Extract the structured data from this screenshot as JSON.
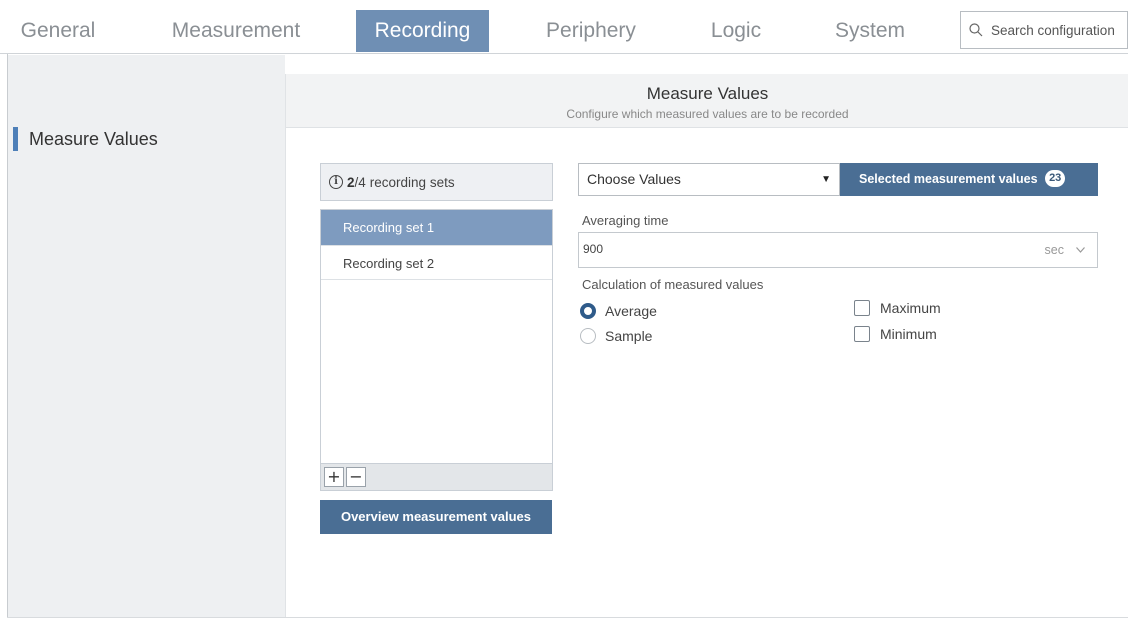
{
  "nav": {
    "tabs": [
      {
        "label": "General"
      },
      {
        "label": "Measurement"
      },
      {
        "label": "Recording"
      },
      {
        "label": "Periphery"
      },
      {
        "label": "Logic"
      },
      {
        "label": "System"
      }
    ],
    "active_tab": "Recording",
    "search_placeholder": "Search configuration"
  },
  "sidebar": {
    "items": [
      {
        "label": "Measure Values"
      }
    ]
  },
  "main": {
    "title": "Measure Values",
    "subtitle": "Configure which measured values are to be recorded",
    "recording_sets": {
      "used": "2",
      "total": "/4",
      "suffix": "recording sets",
      "items": [
        {
          "label": "Recording set 1"
        },
        {
          "label": "Recording set 2"
        }
      ],
      "selected_index": 0,
      "add_label": "+",
      "remove_label": "−"
    },
    "overview_button": "Overview measurement values",
    "choose_values": "Choose Values",
    "selected_button": "Selected measurement values",
    "selected_count": "23",
    "averaging_time": {
      "label": "Averaging time",
      "value": "900",
      "unit": "sec"
    },
    "calculation": {
      "label": "Calculation of measured values",
      "radios": [
        {
          "label": "Average",
          "checked": true
        },
        {
          "label": "Sample",
          "checked": false
        }
      ],
      "checkboxes": [
        {
          "label": "Maximum",
          "checked": false
        },
        {
          "label": "Minimum",
          "checked": false
        }
      ]
    }
  },
  "colors": {
    "accent": "#4a6e94",
    "active_tab": "#6f8fb4",
    "selected_row": "#7e9bbf",
    "sidebar_marker": "#4d7fb8"
  }
}
